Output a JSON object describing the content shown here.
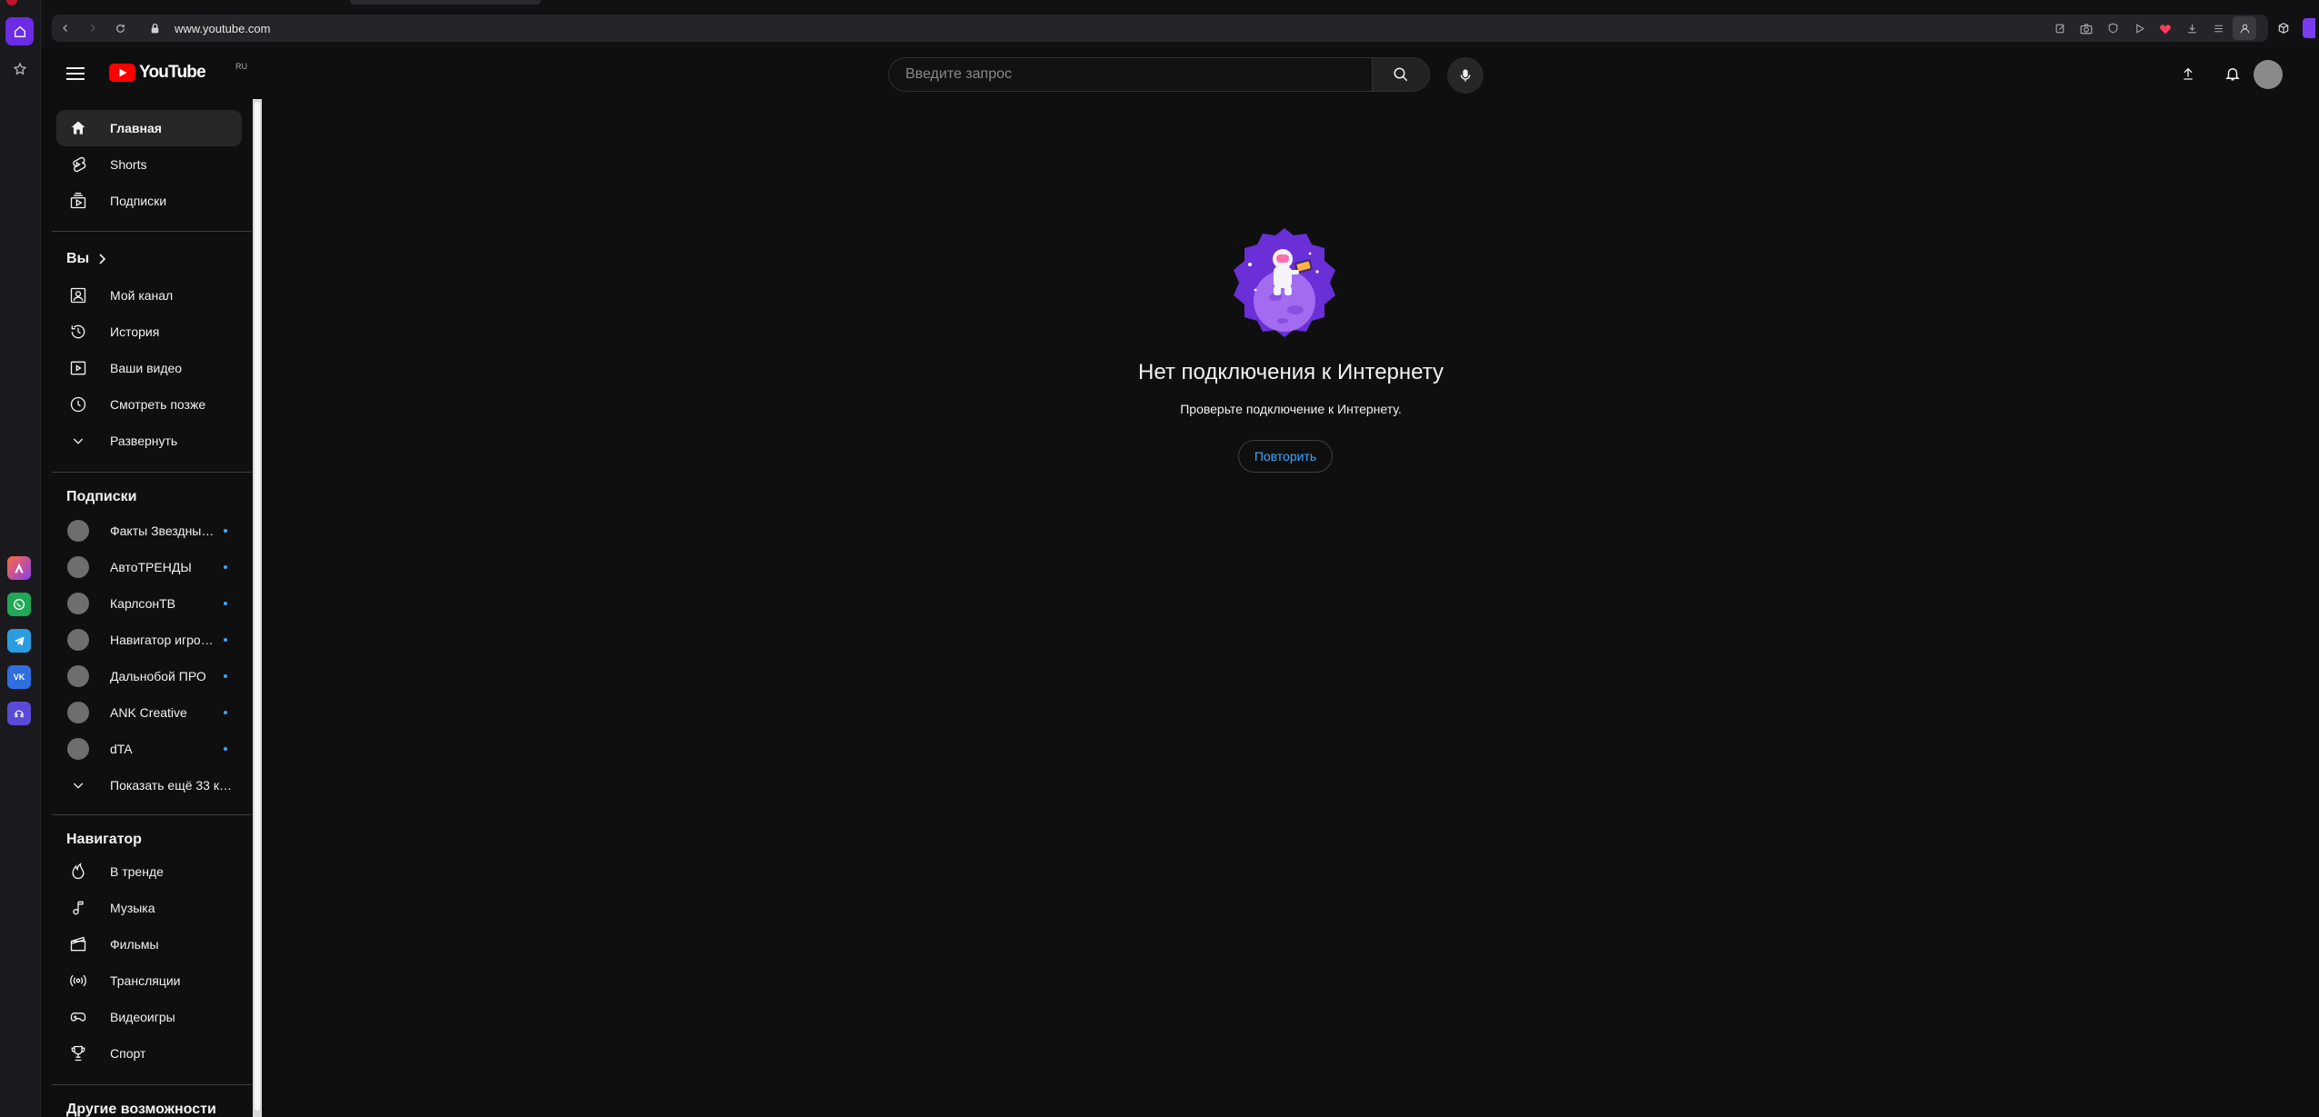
{
  "browser": {
    "url": "www.youtube.com"
  },
  "brand": {
    "logo_text": "YouTube",
    "region": "RU"
  },
  "search": {
    "placeholder": "Введите запрос"
  },
  "sidebar": {
    "main_items": [
      {
        "label": "Главная",
        "icon": "home-icon",
        "active": true
      },
      {
        "label": "Shorts",
        "icon": "shorts-icon"
      },
      {
        "label": "Подписки",
        "icon": "subscriptions-icon"
      }
    ],
    "you_header": "Вы",
    "you_items": [
      {
        "label": "Мой канал",
        "icon": "channel-icon"
      },
      {
        "label": "История",
        "icon": "history-icon"
      },
      {
        "label": "Ваши видео",
        "icon": "your-videos-icon"
      },
      {
        "label": "Смотреть позже",
        "icon": "watch-later-icon"
      },
      {
        "label": "Развернуть",
        "icon": "chevron-down-icon"
      }
    ],
    "subscriptions_header": "Подписки",
    "subscriptions": [
      {
        "label": "Факты Звездны…"
      },
      {
        "label": "АвтоТРЕНДЫ"
      },
      {
        "label": "КарлсонТВ"
      },
      {
        "label": "Навигатор игро…"
      },
      {
        "label": "Дальнобой ПРО"
      },
      {
        "label": "ANK Creative"
      },
      {
        "label": "dTA"
      }
    ],
    "show_more": "Показать ещё 33 к…",
    "explore_header": "Навигатор",
    "explore_items": [
      {
        "label": "В тренде",
        "icon": "trending-icon"
      },
      {
        "label": "Музыка",
        "icon": "music-icon"
      },
      {
        "label": "Фильмы",
        "icon": "films-icon"
      },
      {
        "label": "Трансляции",
        "icon": "live-icon"
      },
      {
        "label": "Видеоигры",
        "icon": "gaming-icon"
      },
      {
        "label": "Спорт",
        "icon": "sport-icon"
      }
    ],
    "more_header": "Другие возможности"
  },
  "offline": {
    "title": "Нет подключения к Интернету",
    "subtitle": "Проверьте подключение к Интернету.",
    "retry": "Повторить"
  },
  "colors": {
    "background": "#0f0f0f",
    "accent_blue": "#3ea6ff",
    "youtube_red": "#ff0000",
    "opera_accent": "#7a3cf0"
  }
}
